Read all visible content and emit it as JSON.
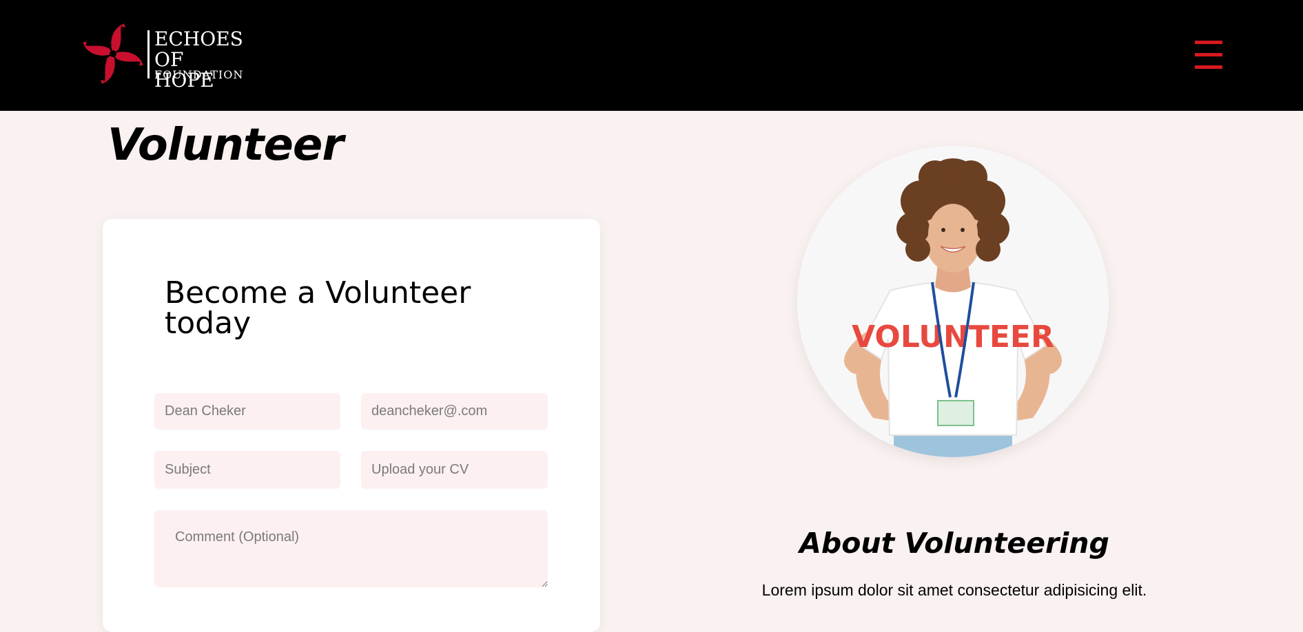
{
  "header": {
    "logo": {
      "line1": "ECHOES",
      "line2": "OF HOPE",
      "line3": "FOUNDATION"
    },
    "menu_icon": "hamburger-menu-icon",
    "colors": {
      "background": "#000000",
      "accent": "#d71920"
    }
  },
  "page": {
    "title": "Volunteer",
    "background": "#faf1f1"
  },
  "form": {
    "heading": "Become a Volunteer today",
    "name_field": {
      "value": "",
      "placeholder": "Dean Cheker"
    },
    "email_field": {
      "value": "",
      "placeholder": "deancheker@.com"
    },
    "subject_field": {
      "value": "",
      "placeholder": "Subject"
    },
    "cv_field": {
      "value": "",
      "placeholder": "Upload your CV"
    },
    "comment_field": {
      "value": "",
      "placeholder": "Comment (Optional)"
    },
    "field_background": "#fcf0f0"
  },
  "sidebar": {
    "photo": "volunteer-woman-photo",
    "shirt_text": "VOLUNTEER",
    "about_title": "About Volunteering",
    "about_text": "Lorem ipsum dolor sit amet consectetur adipisicing elit."
  }
}
